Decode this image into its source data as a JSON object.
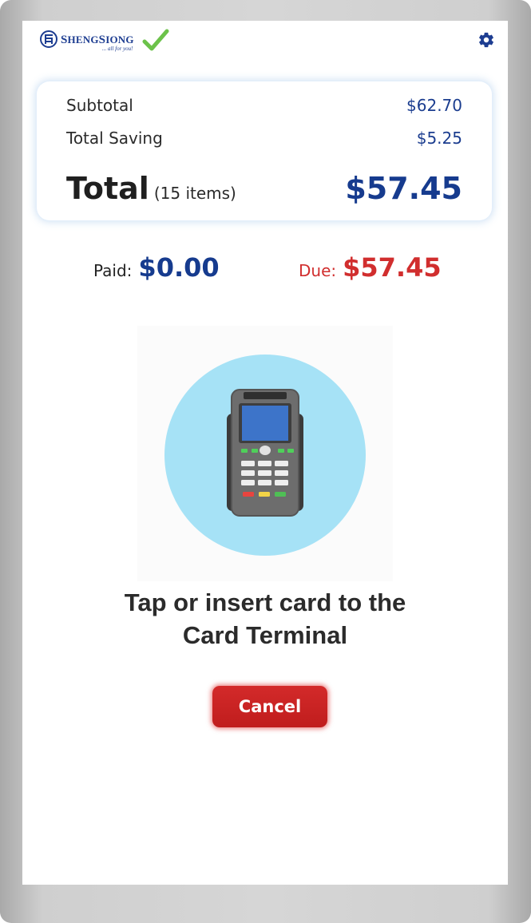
{
  "header": {
    "brand_name_first": "S",
    "brand_name_rest": "HENG",
    "brand_name_second_first": "S",
    "brand_name_second_rest": "IONG",
    "brand_tagline": "... all for you!",
    "settings_icon": "gear-icon"
  },
  "summary": {
    "subtotal_label": "Subtotal",
    "subtotal_value": "$62.70",
    "saving_label": "Total Saving",
    "saving_value": "$5.25",
    "total_label": "Total",
    "total_items": "(15 items)",
    "total_value": "$57.45"
  },
  "payment": {
    "paid_label": "Paid:",
    "paid_value": "$0.00",
    "due_label": "Due:",
    "due_value": "$57.45"
  },
  "instruction": {
    "line1": "Tap or insert card to the",
    "line2": "Card Terminal"
  },
  "actions": {
    "cancel_label": "Cancel"
  },
  "colors": {
    "brand_blue": "#163b8e",
    "due_red": "#d12e2e",
    "cancel_red": "#c81f1f",
    "illustration_circle": "#a6e2f6"
  }
}
